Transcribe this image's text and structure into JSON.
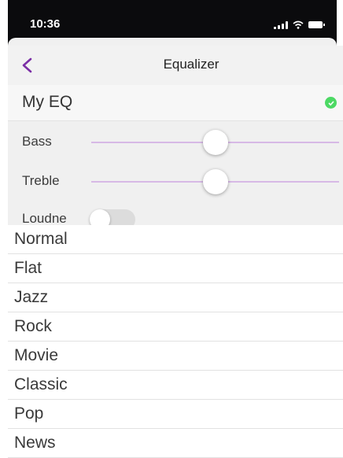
{
  "status_bar": {
    "time": "10:36"
  },
  "nav": {
    "title": "Equalizer",
    "back_icon": "chevron-left-icon",
    "accent_color": "#7b2fa6"
  },
  "my_eq": {
    "label": "My EQ",
    "selected": true,
    "indicator_color": "#4cd964"
  },
  "sliders": [
    {
      "label": "Bass",
      "value": 0.5
    },
    {
      "label": "Treble",
      "value": 0.5
    }
  ],
  "loudness": {
    "label": "Loudne",
    "on": false
  },
  "presets": [
    "Normal",
    "Flat",
    "Jazz",
    "Rock",
    "Movie",
    "Classic",
    "Pop",
    "News"
  ]
}
